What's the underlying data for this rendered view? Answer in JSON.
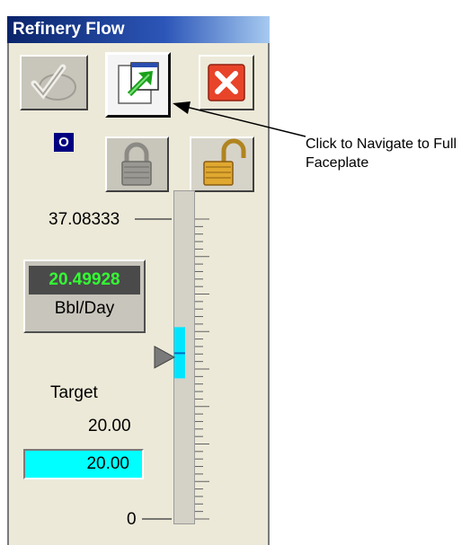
{
  "window": {
    "title": "Refinery Flow"
  },
  "toolbar": {
    "acknowledge": {
      "icon": "acknowledge-check-icon",
      "enabled": false
    },
    "navigate": {
      "icon": "navigate-arrow-icon",
      "enabled": true
    },
    "close": {
      "icon": "close-x-icon",
      "enabled": true
    }
  },
  "status_badge": {
    "text": "O"
  },
  "lock_buttons": {
    "lock": {
      "icon": "lock-closed-icon",
      "enabled": false
    },
    "unlock": {
      "icon": "lock-open-icon",
      "enabled": true
    }
  },
  "scale": {
    "max_label": "37.08333",
    "min_label": "0"
  },
  "pv": {
    "value": "20.49928",
    "units": "Bbl/Day"
  },
  "target": {
    "label": "Target",
    "value": "20.00",
    "input_value": "20.00"
  },
  "markers": {
    "pv_level": 0.5528,
    "target_level": 0.5394
  },
  "colors": {
    "pv_text": "#33ff33",
    "target_bg": "#00ffff",
    "title_bg": "#0a246a"
  },
  "annotation": {
    "text": "Click to Navigate to Full Faceplate"
  }
}
